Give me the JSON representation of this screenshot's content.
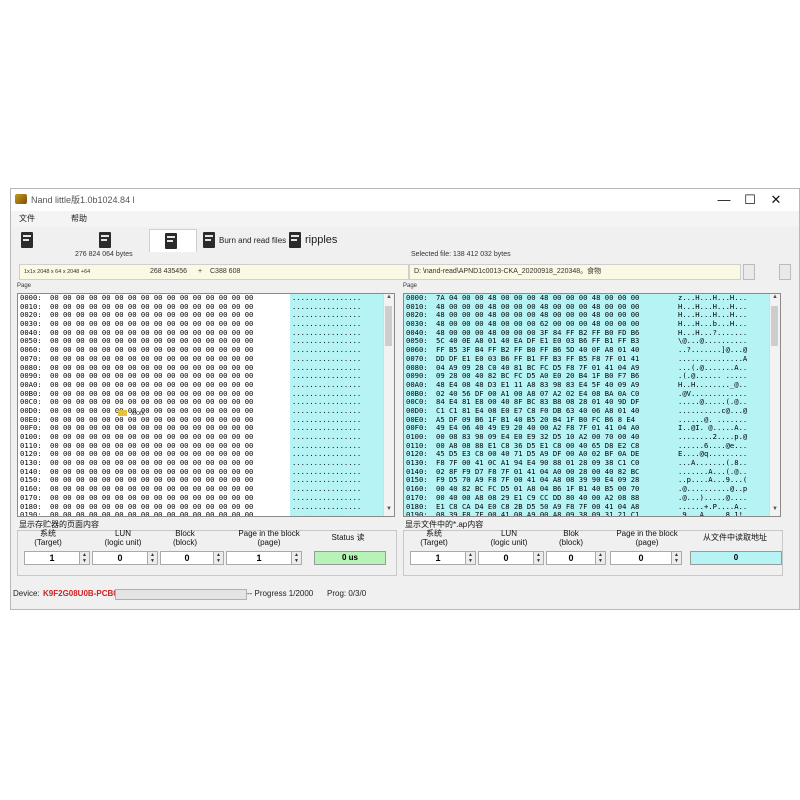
{
  "window": {
    "title": "Nand little版1.0b1024.84 l",
    "controls": {
      "minimize": "—",
      "maximize": "☐",
      "close": "✕"
    }
  },
  "menu": {
    "file": "文件",
    "help": "帮助"
  },
  "toolbar": {
    "burn_label": "Burn and read files",
    "ripples_label": "ripples"
  },
  "info": {
    "left_bytes": "276 824 064 bytes",
    "right_bytes": "Selected file: 138 412 032 bytes",
    "geometry": "1x1x 2048 x 64 x 2048 +64",
    "size_value": "268 435456",
    "plus": "+",
    "id_value": "C388 608",
    "file_path": "D:  \\nand-read\\APND1c0013-CKA_20200918_220348。食物"
  },
  "left_pane": {
    "label": "Page",
    "rows": [
      [
        "0000:",
        "00 00 00 00 00 00 00 00 00 00 00 00 00 00 00 00",
        "................"
      ],
      [
        "0010:",
        "00 00 00 00 00 00 00 00 00 00 00 00 00 00 00 00",
        "................"
      ],
      [
        "0020:",
        "00 00 00 00 00 00 00 00 00 00 00 00 00 00 00 00",
        "................"
      ],
      [
        "0030:",
        "00 00 00 00 00 00 00 00 00 00 00 00 00 00 00 00",
        "................"
      ],
      [
        "0040:",
        "00 00 00 00 00 00 00 00 00 00 00 00 00 00 00 00",
        "................"
      ],
      [
        "0050:",
        "00 00 00 00 00 00 00 00 00 00 00 00 00 00 00 00",
        "................"
      ],
      [
        "0060:",
        "00 00 00 00 00 00 00 00 00 00 00 00 00 00 00 00",
        "................"
      ],
      [
        "0070:",
        "00 00 00 00 00 00 00 00 00 00 00 00 00 00 00 00",
        "................"
      ],
      [
        "0080:",
        "00 00 00 00 00 00 00 00 00 00 00 00 00 00 00 00",
        "................"
      ],
      [
        "0090:",
        "00 00 00 00 00 00 00 00 00 00 00 00 00 00 00 00",
        "................"
      ],
      [
        "00A0:",
        "00 00 00 00 00 00 00 00 00 00 00 00 00 00 00 00",
        "................"
      ],
      [
        "00B0:",
        "00 00 00 00 00 00 00 00 00 00 00 00 00 00 00 00",
        "................"
      ],
      [
        "00C0:",
        "00 00 00 00 00 00 00 00 00 00 00 00 00 00 00 00",
        "................"
      ],
      [
        "00D0:",
        "00 00 00 00 00 00 00 00 00 00 00 00 00 00 00 00",
        "................"
      ],
      [
        "00E0:",
        "00 00 00 00 00 00 00 00 00 00 00 00 00 00 00 00",
        "................"
      ],
      [
        "00F0:",
        "00 00 00 00 00 00 00 00 00 00 00 00 00 00 00 00",
        "................"
      ],
      [
        "0100:",
        "00 00 00 00 00 00 00 00 00 00 00 00 00 00 00 00",
        "................"
      ],
      [
        "0110:",
        "00 00 00 00 00 00 00 00 00 00 00 00 00 00 00 00",
        "................"
      ],
      [
        "0120:",
        "00 00 00 00 00 00 00 00 00 00 00 00 00 00 00 00",
        "................"
      ],
      [
        "0130:",
        "00 00 00 00 00 00 00 00 00 00 00 00 00 00 00 00",
        "................"
      ],
      [
        "0140:",
        "00 00 00 00 00 00 00 00 00 00 00 00 00 00 00 00",
        "................"
      ],
      [
        "0150:",
        "00 00 00 00 00 00 00 00 00 00 00 00 00 00 00 00",
        "................"
      ],
      [
        "0160:",
        "00 00 00 00 00 00 00 00 00 00 00 00 00 00 00 00",
        "................"
      ],
      [
        "0170:",
        "00 00 00 00 00 00 00 00 00 00 00 00 00 00 00 00",
        "................"
      ],
      [
        "0180:",
        "00 00 00 00 00 00 00 00 00 00 00 00 00 00 00 00",
        "................"
      ],
      [
        "0190:",
        "00 00 00 00 00 00 00 00 00 00 00 00 00 00 00 00",
        "................"
      ],
      [
        "01A0:",
        "00 00 00 00 00 00 00 00 00 00 00 00 00 00 00 00",
        "................"
      ],
      [
        "01B0:",
        "00 00 00 00 00 00 00 00 00 00 00 00 00 00 00 00",
        "................"
      ],
      [
        "01C0:",
        "00 00 00 00 00 00 00 00 00 00 00 00 00 00 00 00",
        "................"
      ],
      [
        "01D0:",
        "00 00 00 00 00 00 00 00 00 00 00 00 00 00 00 00",
        "................"
      ]
    ]
  },
  "right_pane": {
    "label": "Page",
    "rows": [
      [
        "0000:",
        "7A 04 00 00 48 00 00 00 48 00 00 00 48 00 00 00",
        "z...H...H...H..."
      ],
      [
        "0010:",
        "48 00 00 00 48 00 00 00 48 00 00 00 48 00 00 00",
        "H...H...H...H..."
      ],
      [
        "0020:",
        "48 00 00 00 48 00 00 00 48 00 00 00 48 00 00 00",
        "H...H...H...H..."
      ],
      [
        "0030:",
        "48 00 00 00 48 00 00 00 62 00 00 00 48 00 00 00",
        "H...H...b...H..."
      ],
      [
        "0040:",
        "48 00 00 00 48 00 00 00 3F 84 FF B2 FF B0 FD B6",
        "H...H...?......."
      ],
      [
        "0050:",
        "5C 40 0E A8 01 40 EA DF E1 E0 03 B6 FF B1 FF B3",
        "\\@...@.........."
      ],
      [
        "0060:",
        "FF B5 3F B4 FF B2 FF B0 FF B6 5D 40 0F A8 01 40",
        "..?.......]@...@"
      ],
      [
        "0070:",
        "DD DF E1 E0 03 B6 FF B1 FF B3 FF B5 F8 7F 01 41",
        "...............A"
      ],
      [
        "0080:",
        "04 A9 09 28 C0 40 81 BC FC D5 F8 7F 01 41 04 A9",
        "...(.@.......A.."
      ],
      [
        "0090:",
        "09 28 00 40 82 BC FC D5 A0 E0 20 B4 1F B0 F7 B6",
        ".(.@...... ....."
      ],
      [
        "00A0:",
        "48 E4 08 48 D3 E1 11 A8 83 98 83 E4 5F 40 09 A9",
        "H..H........_@.."
      ],
      [
        "00B0:",
        "02 40 56 DF 00 A1 00 A8 07 A2 02 E4 08 BA 0A C0",
        ".@V............."
      ],
      [
        "00C0:",
        "84 E4 81 E8 00 40 8F BC 83 B8 08 28 01 40 9D DF",
        ".....@.....(.@.."
      ],
      [
        "00D0:",
        "C1 C1 81 E4 08 E0 E7 C8 F0 DB 63 40 06 A8 01 40",
        "..........c@...@"
      ],
      [
        "00E0:",
        "A5 DF 09 B6 1F B1 40 B5 20 B4 1F B0 FC B6 8 E4",
        "......@. ......."
      ],
      [
        "00F0:",
        "49 E4 06 40 49 E9 20 40 00 A2 F8 7F 01 41 04 A0",
        "I..@I. @.....A.."
      ],
      [
        "0100:",
        "00 08 83 98 09 E4 E0 E9 32 D5 10 A2 00 70 00 40",
        "........2....p.@"
      ],
      [
        "0110:",
        "00 A8 08 88 E1 C8 36 D5 E1 C8 00 40 65 D8 E2 C8",
        "......6....@e..."
      ],
      [
        "0120:",
        "45 D5 E3 C8 00 40 71 D5 A9 DF 00 A0 02 BF 0A DE",
        "E....@q........."
      ],
      [
        "0130:",
        "F8 7F 00 41 0C A1 94 E4 90 88 01 28 09 38 C1 C0",
        "...A.......(.8.."
      ],
      [
        "0140:",
        "02 8F F9 D7 F8 7F 01 41 04 A0 00 28 00 40 82 BC",
        ".......A...(.@.."
      ],
      [
        "0150:",
        "F9 D5 70 A9 F8 7F 00 41 04 A8 08 39 90 E4 09 28",
        "..p....A...9...("
      ],
      [
        "0160:",
        "00 40 82 BC FC D5 01 A8 04 B6 1F B1 40 B5 00 70",
        ".@..........@..p"
      ],
      [
        "0170:",
        "00 40 00 A8 08 29 E1 C9 CC DD 80 40 00 A2 08 88",
        ".@...).....@...."
      ],
      [
        "0180:",
        "E1 C8 CA D4 E0 C8 2B D5 50 A9 F8 7F 00 41 04 A8",
        "......+.P....A.."
      ],
      [
        "0190:",
        "08 39 F8 7F 00 41 08 A9 00 A8 09 38 09 31 21 C1",
        ".9...A.....8.1!."
      ],
      [
        "01A0:",
        "09 31 21 C1 00 40 11 BC 09 31 BE DE 00 A9 F8 7F",
        ".1!..@...1......"
      ],
      [
        "01B0:",
        "00 41 04 A8 08 39 F8 7F 00 41 08 A3 03 39 E0 C0",
        ".A...9...A...9.."
      ],
      [
        "01C0:",
        "08 31 30 A9 F8 7F 00 41 08 A8 08 38 31 21 C1",
        ".10....A...81!.."
      ],
      [
        "01D0:",
        "38 D5 08 A8 03 38 F8 7F 00 41 08 A8 08 38 31 21",
        "8....8...A...81!"
      ]
    ]
  },
  "left_ctl": {
    "title": "显示存贮器的页面内容",
    "system_label": "系统\n(Target)",
    "lun_label": "LUN\n(logic unit)",
    "block_label": "Block\n(block)",
    "page_label": "Page in the block\n(page)",
    "status_label": "Status 读",
    "system_val": "1",
    "lun_val": "0",
    "block_val": "0",
    "page_val": "1",
    "status_val": "0 us"
  },
  "right_ctl": {
    "title": "显示文件中的*.ap内容",
    "system_label": "系统\n(Target)",
    "lun_label": "LUN\n(logic unit)",
    "block_label": "Blok\n(block)",
    "page_label": "Page in the block\n(page)",
    "addr_label": "从文件中读取地址",
    "system_val": "1",
    "lun_val": "0",
    "block_val": "0",
    "page_val": "0",
    "addr_val": "0"
  },
  "status": {
    "device_label": "Device:",
    "device_val": "K9F2G08U0B-PCB0",
    "progress_text": "-- Progress 1/2000",
    "prog_text": "Prog: 0/3/0",
    "progress_fraction": 0.0005
  },
  "folder": {
    "name": "xxxx"
  },
  "colors": {
    "hex_bg": "#b5f3f5",
    "status_bg": "#b7f3b6",
    "device_text": "#d02020"
  }
}
